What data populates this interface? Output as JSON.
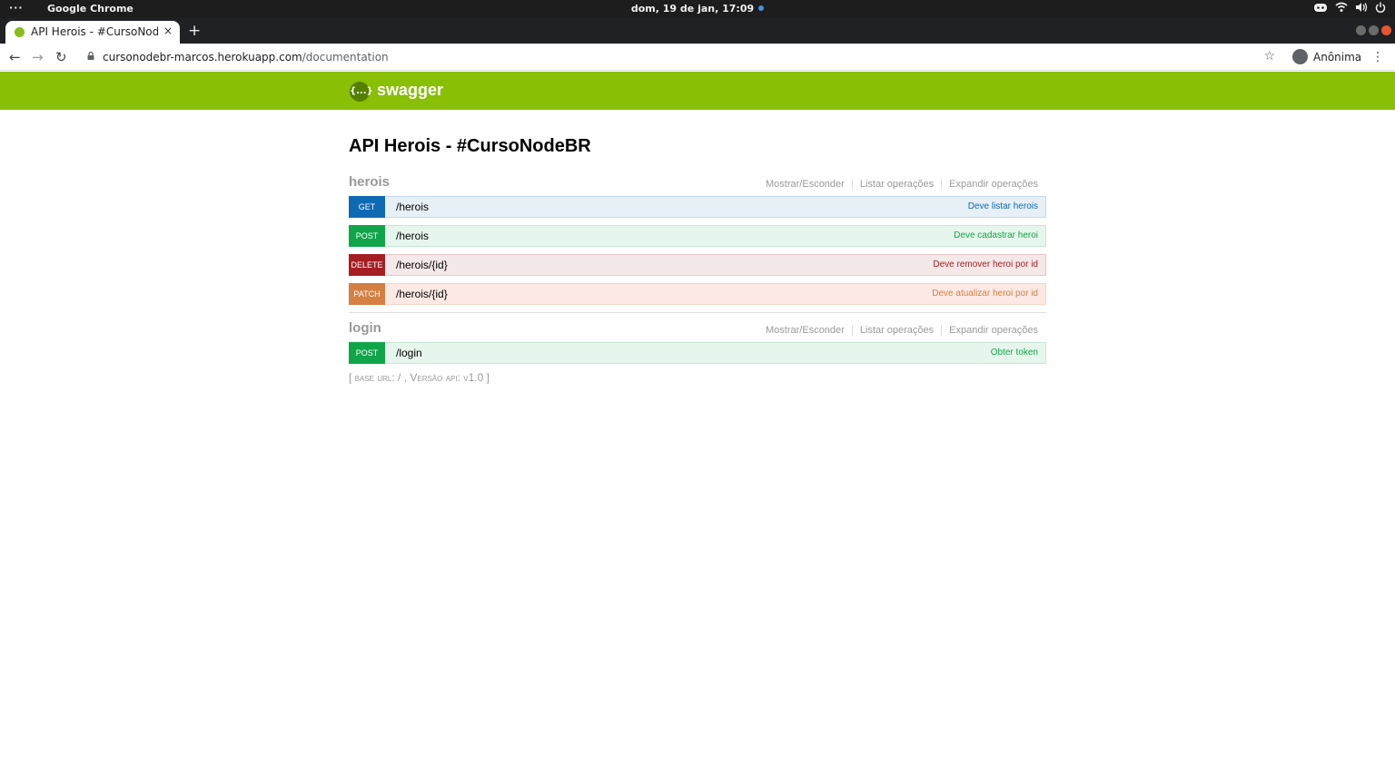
{
  "system": {
    "dots": "···",
    "app_name": "Google Chrome",
    "clock": "dom, 19 de jan, 17:09"
  },
  "browser": {
    "tab_title": "API Herois - #CursoNodeBR",
    "tab_close": "×",
    "new_tab": "+",
    "url_host": "cursonodebr-marcos.herokuapp.com",
    "url_path": "/documentation",
    "profile_name": "Anônima"
  },
  "swagger": {
    "logo_icon": "{...}",
    "logo_text": "swagger"
  },
  "api": {
    "title": "API Herois - #CursoNodeBR",
    "groups": [
      {
        "name": "herois",
        "links": [
          "Mostrar/Esconder",
          "Listar operações",
          "Expandir operações"
        ],
        "operations": [
          {
            "method": "GET",
            "path": "/herois",
            "summary": "Deve listar herois"
          },
          {
            "method": "POST",
            "path": "/herois",
            "summary": "Deve cadastrar heroi"
          },
          {
            "method": "DELETE",
            "path": "/herois/{id}",
            "summary": "Deve remover heroi por id"
          },
          {
            "method": "PATCH",
            "path": "/herois/{id}",
            "summary": "Deve atualizar heroi por id"
          }
        ]
      },
      {
        "name": "login",
        "links": [
          "Mostrar/Esconder",
          "Listar operações",
          "Expandir operações"
        ],
        "operations": [
          {
            "method": "POST",
            "path": "/login",
            "summary": "Obter token"
          }
        ]
      }
    ],
    "footer": "[ base url: / , Versão api: v1.0 ]"
  },
  "colors": {
    "swagger_green": "#89bf04",
    "get": "#0f6ab4",
    "post": "#10a54a",
    "delete": "#a41e22",
    "patch": "#d38042"
  }
}
